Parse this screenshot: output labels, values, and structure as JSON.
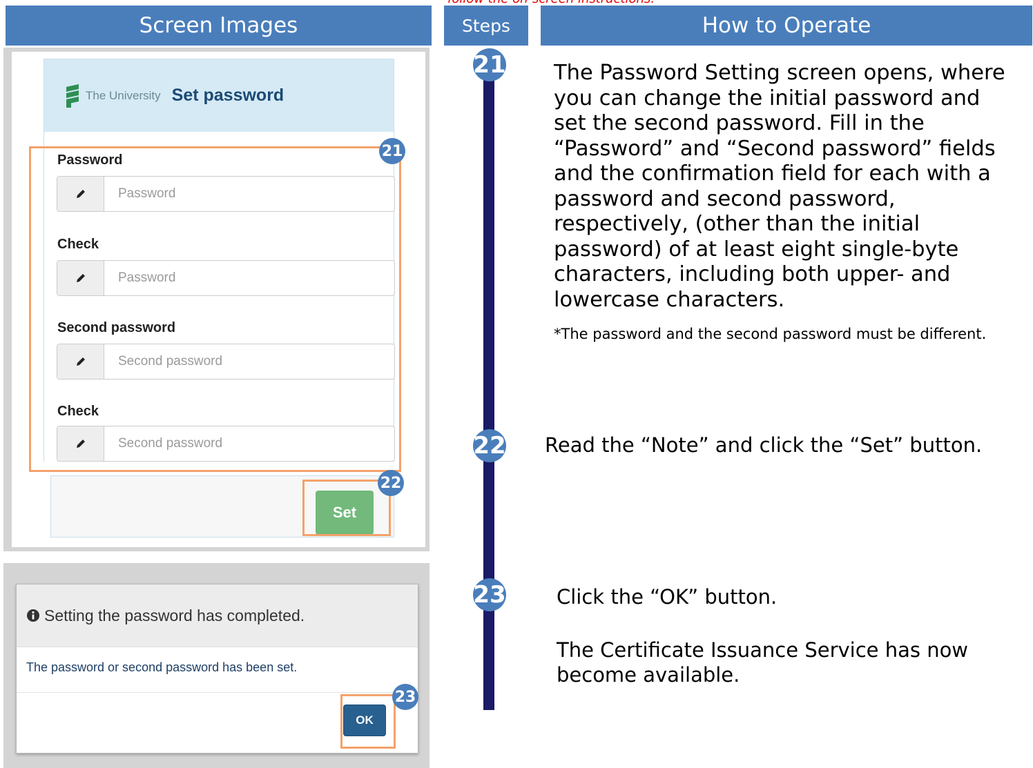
{
  "top_note": "follow the on-screen instructions.",
  "headers": {
    "screen_images": "Screen Images",
    "steps": "Steps",
    "how_to_operate": "How to Operate"
  },
  "set_password_screen": {
    "logo_text": "The University",
    "title": "Set password",
    "fields": [
      {
        "label": "Password",
        "placeholder": "Password"
      },
      {
        "label": "Check",
        "placeholder": "Password"
      },
      {
        "label": "Second password",
        "placeholder": "Second password"
      },
      {
        "label": "Check",
        "placeholder": "Second password"
      }
    ],
    "set_button": "Set"
  },
  "completion_dialog": {
    "title": "Setting the password has completed.",
    "message": "The password or second password has been set.",
    "ok_button": "OK"
  },
  "steps": [
    {
      "number": "21",
      "text": "The Password Setting screen opens, where you can change the initial password and set the second password. Fill in the “Password” and “Second password” fields and the confirmation field for each with a password and second password, respectively, (other than the initial password) of at least eight single-byte characters, including both upper- and lowercase characters.",
      "note": "*The password and the second password must be different."
    },
    {
      "number": "22",
      "text": "Read the “Note” and click the “Set” button."
    },
    {
      "number": "23",
      "text": "Click the “OK” button.",
      "text2": "The Certificate Issuance Service has now become available."
    }
  ],
  "colors": {
    "header_blue": "#4a7ebb",
    "timeline": "#1a1a66",
    "highlight_orange": "#f4a26b",
    "set_button_green": "#72b97b",
    "ok_button_blue": "#286090"
  }
}
